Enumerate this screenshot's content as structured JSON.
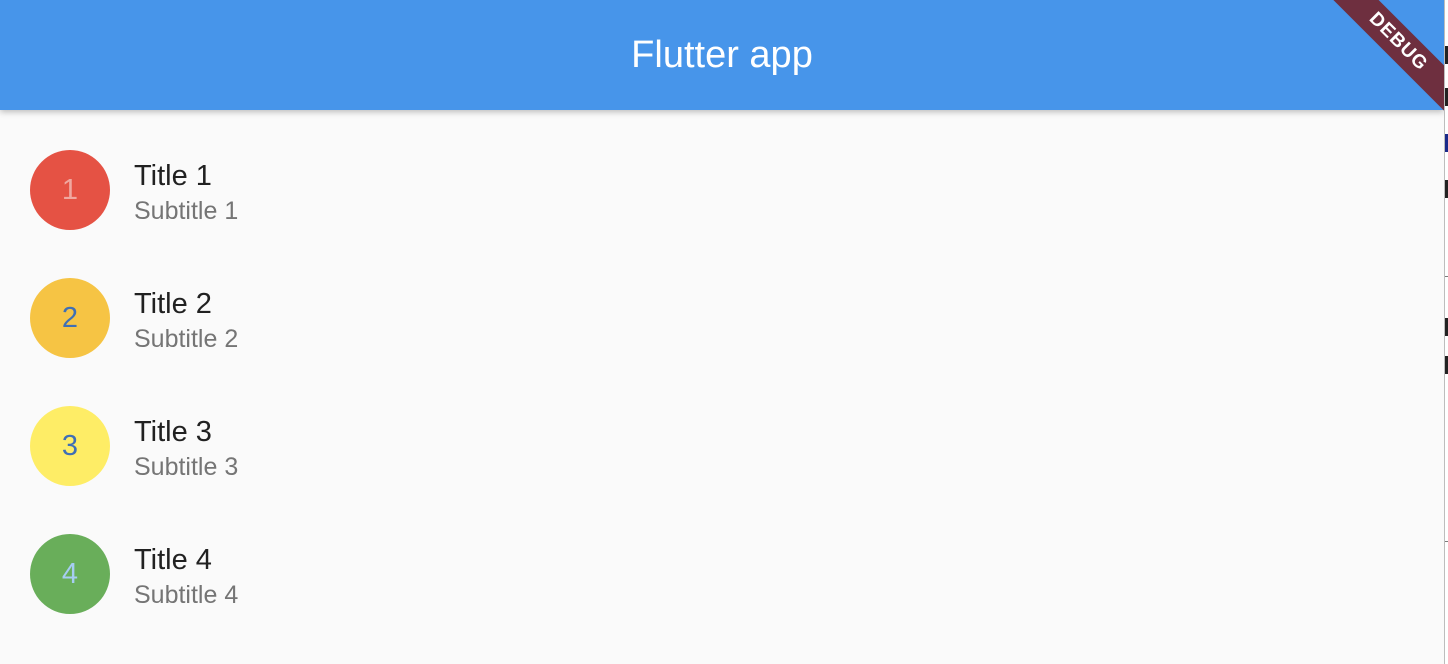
{
  "app_bar": {
    "title": "Flutter app",
    "color": "#4795ea"
  },
  "debug_banner": {
    "label": "DEBUG",
    "color": "#6e2f3f"
  },
  "list": {
    "items": [
      {
        "avatar_text": "1",
        "title": "Title 1",
        "subtitle": "Subtitle 1",
        "avatar_color": "#e55244",
        "avatar_text_color": "#f0a8a0"
      },
      {
        "avatar_text": "2",
        "title": "Title 2",
        "subtitle": "Subtitle 2",
        "avatar_color": "#f6c444",
        "avatar_text_color": "#3f6fb5"
      },
      {
        "avatar_text": "3",
        "title": "Title 3",
        "subtitle": "Subtitle 3",
        "avatar_color": "#feed66",
        "avatar_text_color": "#3f6fb5"
      },
      {
        "avatar_text": "4",
        "title": "Title 4",
        "subtitle": "Subtitle 4",
        "avatar_color": "#69ae5a",
        "avatar_text_color": "#a6cdf2"
      }
    ]
  }
}
